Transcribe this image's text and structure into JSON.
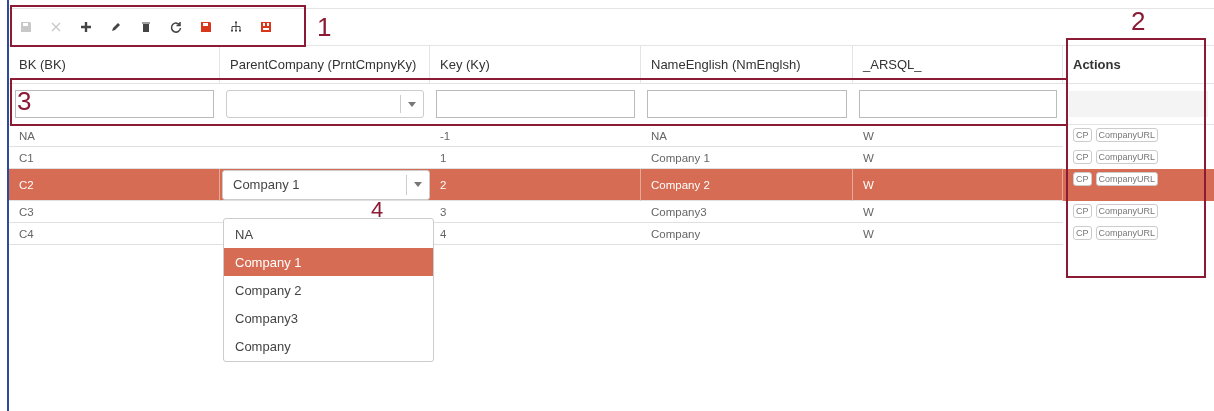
{
  "toolbar": [
    {
      "kind": "save",
      "disabled": true
    },
    {
      "kind": "cancel",
      "disabled": true
    },
    {
      "kind": "add",
      "disabled": false
    },
    {
      "kind": "edit",
      "disabled": false
    },
    {
      "kind": "delete",
      "disabled": false
    },
    {
      "kind": "refresh",
      "disabled": false
    },
    {
      "kind": "save-red",
      "disabled": false
    },
    {
      "kind": "hierarchy",
      "disabled": false
    },
    {
      "kind": "save-all",
      "disabled": false
    }
  ],
  "columns": [
    "BK (BK)",
    "ParentCompany (PrntCmpnyKy)",
    "Key (Ky)",
    "NameEnglish (NmEnglsh)",
    "_ARSQL_",
    "Actions"
  ],
  "filters": [
    {
      "kind": "text"
    },
    {
      "kind": "select"
    },
    {
      "kind": "text"
    },
    {
      "kind": "text"
    },
    {
      "kind": "text"
    },
    {
      "kind": "none"
    }
  ],
  "rows": [
    {
      "bk": "NA",
      "key": "-1",
      "name": "NA",
      "arsql": "W",
      "selected": false,
      "actions": [
        "CP",
        "CompanyURL"
      ]
    },
    {
      "bk": "C1",
      "key": "1",
      "name": "Company 1",
      "arsql": "W",
      "selected": false,
      "actions": [
        "CP",
        "CompanyURL"
      ]
    },
    {
      "bk": "C2",
      "key": "2",
      "name": "Company 2",
      "arsql": "W",
      "selected": true,
      "actions": [
        "CP",
        "CompanyURL"
      ],
      "parent_editor": {
        "value": "Company 1",
        "options": [
          {
            "label": "NA",
            "selected": false
          },
          {
            "label": "Company 1",
            "selected": true
          },
          {
            "label": "Company 2",
            "selected": false
          },
          {
            "label": "Company3",
            "selected": false
          },
          {
            "label": "Company",
            "selected": false
          }
        ]
      }
    },
    {
      "bk": "C3",
      "key": "3",
      "name": "Company3",
      "arsql": "W",
      "selected": false,
      "actions": [
        "CP",
        "CompanyURL"
      ]
    },
    {
      "bk": "C4",
      "key": "4",
      "name": "Company",
      "arsql": "W",
      "selected": false,
      "actions": [
        "CP",
        "CompanyURL"
      ]
    }
  ],
  "annotations": {
    "toolbar": "1",
    "actions": "2",
    "filters": "3",
    "dropdown": "4"
  }
}
